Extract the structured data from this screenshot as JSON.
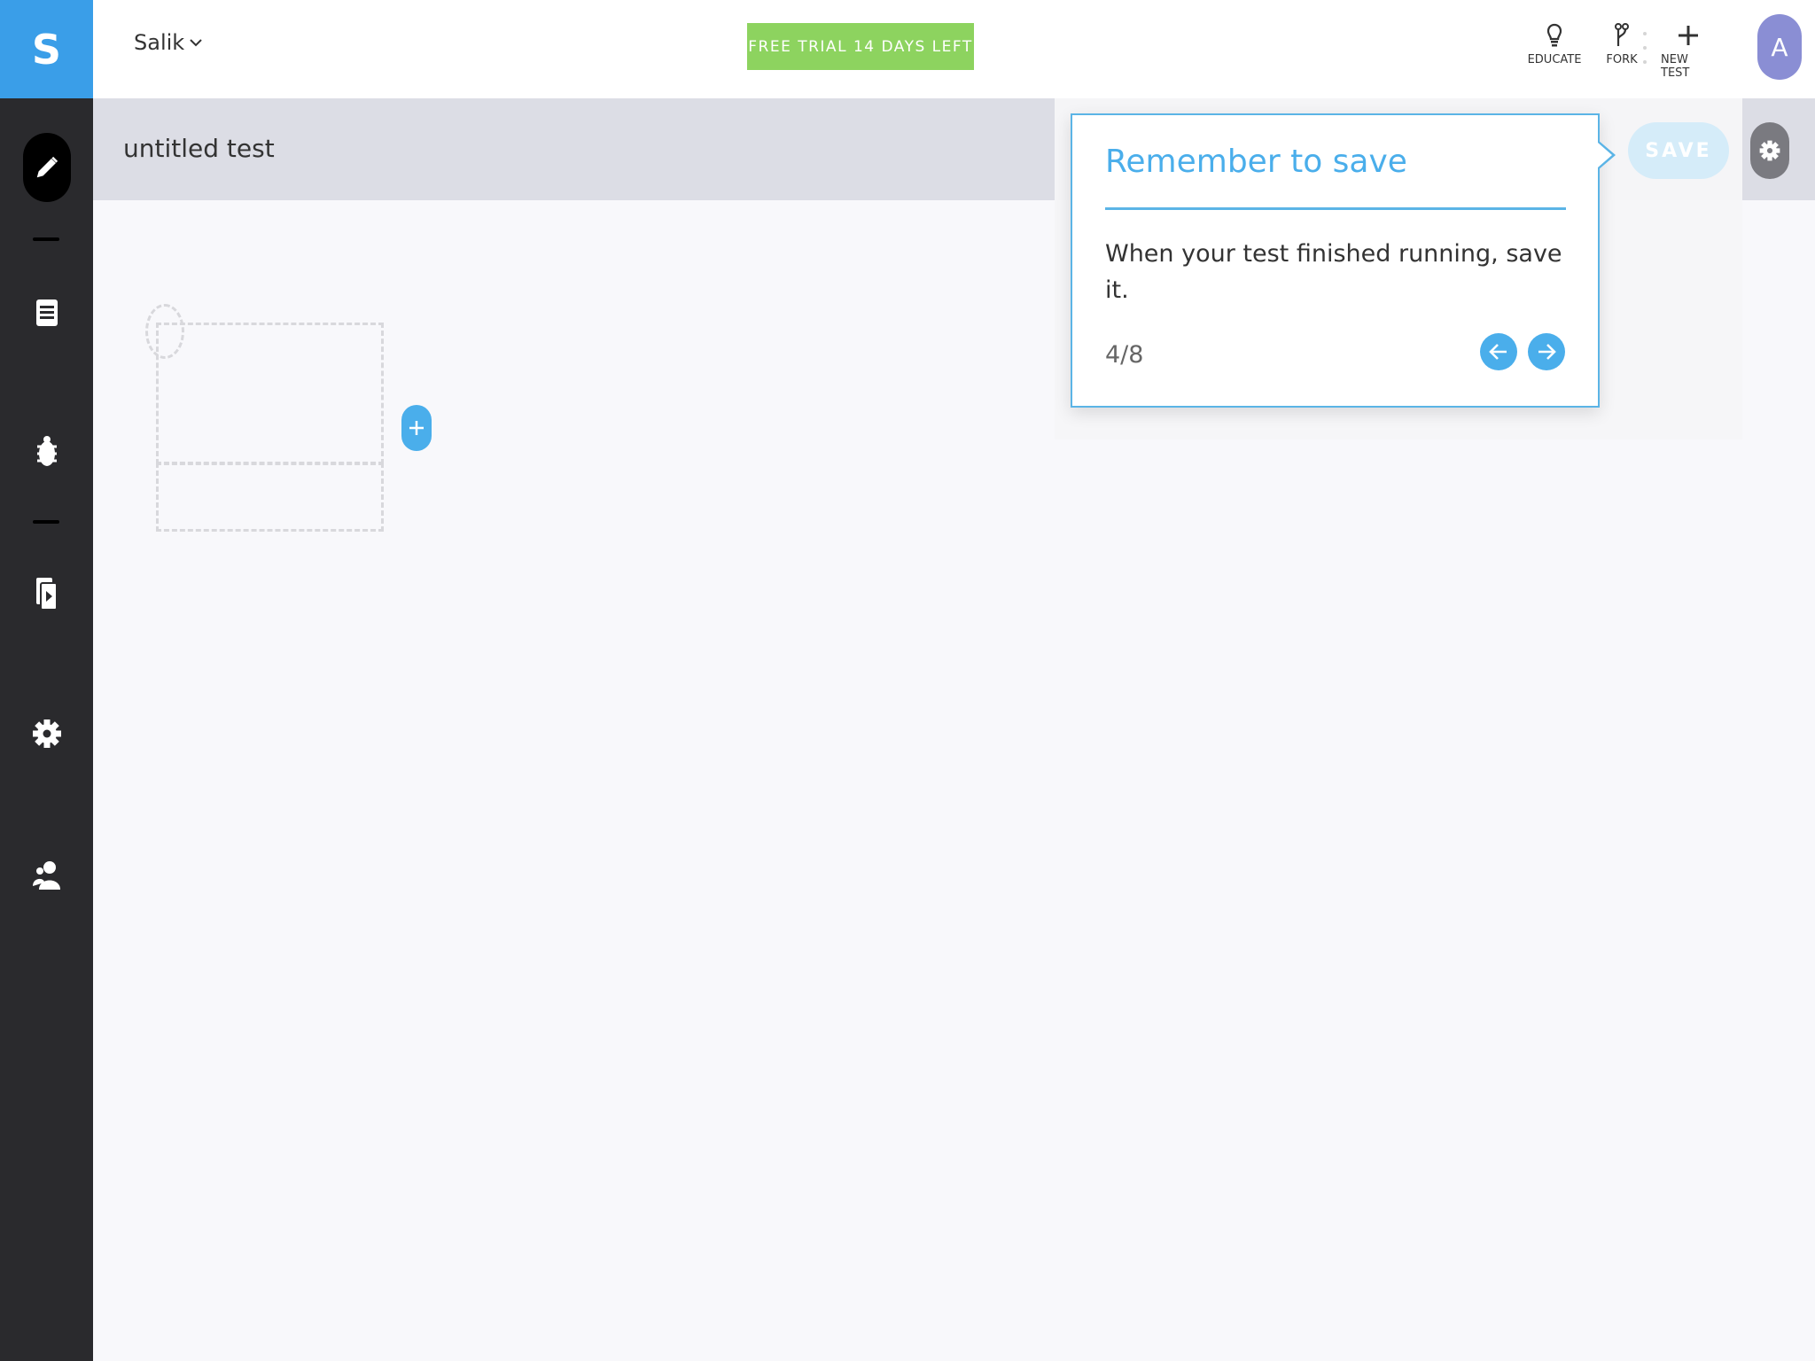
{
  "app": {
    "brand_letter": "S",
    "workspace_name": "Salik",
    "trial_label": "FREE TRIAL 14 DAYS LEFT",
    "avatar_initial": "A"
  },
  "top_actions": [
    {
      "label": "EDUCATE",
      "icon": "lightbulb-icon"
    },
    {
      "label": "FORK",
      "icon": "fork-icon"
    },
    {
      "label": "NEW TEST",
      "icon": "plus-icon"
    }
  ],
  "sidebar": {
    "items": [
      {
        "icon": "pencil-icon",
        "active": true
      },
      {
        "icon": "list-icon",
        "active": false
      },
      {
        "icon": "bug-icon",
        "active": false
      },
      {
        "icon": "run-copy-icon",
        "active": false
      },
      {
        "icon": "gear-icon",
        "active": false
      },
      {
        "icon": "users-icon",
        "active": false
      }
    ]
  },
  "test": {
    "name": "untitled test",
    "save_label": "SAVE"
  },
  "popover": {
    "title": "Remember to save",
    "body": "When your test finished running, save it.",
    "counter": "4/8"
  },
  "colors": {
    "brand_blue": "#3a9ee8",
    "trial_green": "#8dd35f",
    "accent_blue": "#4aaeeb",
    "sidebar_dark": "#2a2a2d",
    "avatar_purple": "#8a8ed4"
  }
}
